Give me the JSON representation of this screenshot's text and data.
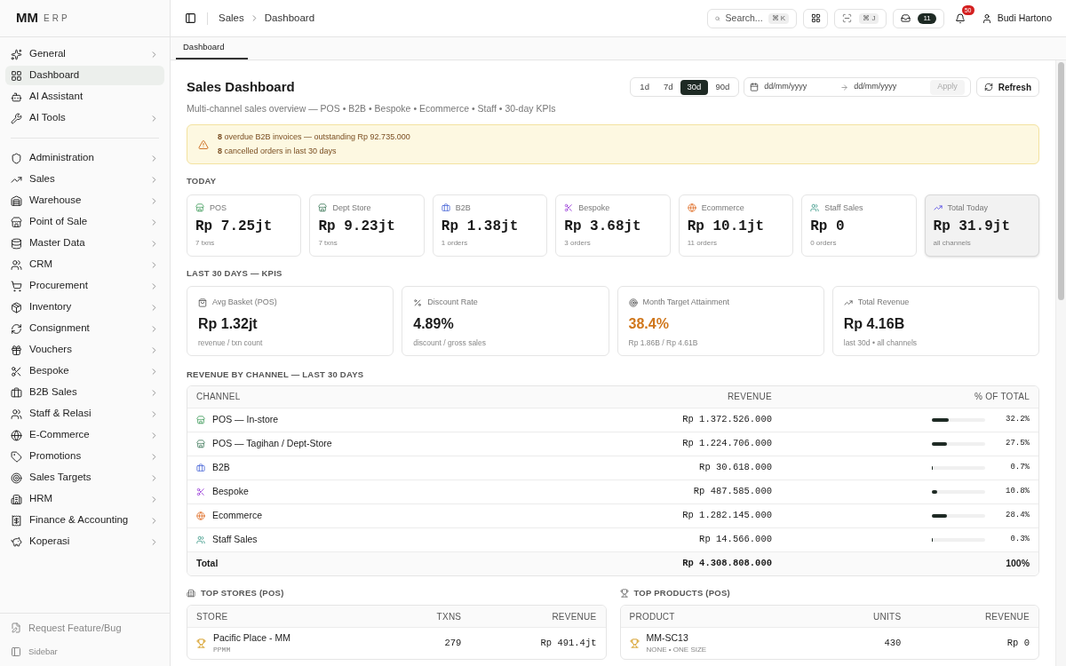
{
  "brand": {
    "name": "MM",
    "suffix": "ERP"
  },
  "sidebar": {
    "groups": [
      [
        {
          "label": "General",
          "expandable": true,
          "selected": false
        },
        {
          "label": "Dashboard",
          "expandable": false,
          "selected": true
        },
        {
          "label": "AI Assistant",
          "expandable": false,
          "selected": false
        },
        {
          "label": "AI Tools",
          "expandable": true,
          "selected": false
        }
      ],
      [
        {
          "label": "Administration",
          "expandable": true,
          "selected": false
        },
        {
          "label": "Sales",
          "expandable": true,
          "selected": false
        },
        {
          "label": "Warehouse",
          "expandable": true,
          "selected": false
        },
        {
          "label": "Point of Sale",
          "expandable": true,
          "selected": false
        },
        {
          "label": "Master Data",
          "expandable": true,
          "selected": false
        },
        {
          "label": "CRM",
          "expandable": true,
          "selected": false
        },
        {
          "label": "Procurement",
          "expandable": true,
          "selected": false
        },
        {
          "label": "Inventory",
          "expandable": true,
          "selected": false
        },
        {
          "label": "Consignment",
          "expandable": true,
          "selected": false
        },
        {
          "label": "Vouchers",
          "expandable": true,
          "selected": false
        },
        {
          "label": "Bespoke",
          "expandable": true,
          "selected": false
        },
        {
          "label": "B2B Sales",
          "expandable": true,
          "selected": false
        },
        {
          "label": "Staff & Relasi",
          "expandable": true,
          "selected": false
        },
        {
          "label": "E-Commerce",
          "expandable": true,
          "selected": false
        },
        {
          "label": "Promotions",
          "expandable": true,
          "selected": false
        },
        {
          "label": "Sales Targets",
          "expandable": true,
          "selected": false
        },
        {
          "label": "HRM",
          "expandable": true,
          "selected": false
        },
        {
          "label": "Finance & Accounting",
          "expandable": true,
          "selected": false
        },
        {
          "label": "Koperasi",
          "expandable": true,
          "selected": false
        }
      ]
    ],
    "footer": [
      "Request Feature/Bug",
      "Sidebar"
    ]
  },
  "breadcrumb": [
    "Sales",
    "Dashboard"
  ],
  "topbar": {
    "search_placeholder": "Search...",
    "search_shortcut": "⌘ K",
    "scan_shortcut": "⌘ J",
    "inbox_count": "11",
    "notification_count": "50",
    "user": "Budi Hartono"
  },
  "tabs": [
    {
      "label": "Dashboard",
      "selected": true
    }
  ],
  "page": {
    "title": "Sales Dashboard",
    "subtitle": "Multi-channel sales overview — POS • B2B • Bespoke • Ecommerce • Staff • 30-day KPIs",
    "periods": [
      {
        "label": "1d",
        "selected": false
      },
      {
        "label": "7d",
        "selected": false
      },
      {
        "label": "30d",
        "selected": true
      },
      {
        "label": "90d",
        "selected": false
      }
    ],
    "date_from": {
      "placeholder": "dd/mm/yyyy"
    },
    "date_to": {
      "placeholder": "dd/mm/yyyy"
    },
    "apply": "Apply",
    "refresh": "Refresh"
  },
  "alert": [
    "**8** overdue B2B invoices — outstanding Rp 92.735.000",
    "**8** cancelled orders in last 30 days"
  ],
  "today": {
    "heading": "TODAY",
    "cards": [
      {
        "label": "POS",
        "value": "Rp 7.25jt",
        "note": "7 txns",
        "highlighted": false
      },
      {
        "label": "Dept Store",
        "value": "Rp 9.23jt",
        "note": "7 txns",
        "highlighted": false
      },
      {
        "label": "B2B",
        "value": "Rp 1.38jt",
        "note": "1 orders",
        "highlighted": false
      },
      {
        "label": "Bespoke",
        "value": "Rp 3.68jt",
        "note": "3 orders",
        "highlighted": false
      },
      {
        "label": "Ecommerce",
        "value": "Rp 10.1jt",
        "note": "11 orders",
        "highlighted": false
      },
      {
        "label": "Staff Sales",
        "value": "Rp 0",
        "note": "0 orders",
        "highlighted": false
      },
      {
        "label": "Total Today",
        "value": "Rp 31.9jt",
        "note": "all channels",
        "highlighted": true
      }
    ]
  },
  "kpis": {
    "heading": "LAST 30 DAYS — KPIS",
    "cards": [
      {
        "label": "Avg Basket (POS)",
        "value": "Rp 1.32jt",
        "note": "revenue / txn count",
        "accent": false
      },
      {
        "label": "Discount Rate",
        "value": "4.89%",
        "note": "discount / gross sales",
        "accent": false
      },
      {
        "label": "Month Target Attainment",
        "value": "38.4%",
        "note": "Rp 1.86B / Rp 4.61B",
        "accent": true
      },
      {
        "label": "Total Revenue",
        "value": "Rp 4.16B",
        "note": "last 30d • all channels",
        "accent": false
      }
    ]
  },
  "revenue_by_channel": {
    "heading": "REVENUE BY CHANNEL — LAST 30 DAYS",
    "columns": [
      "CHANNEL",
      "REVENUE",
      "% OF TOTAL"
    ],
    "rows": [
      {
        "channel": "POS — In-store",
        "revenue": "Rp 1.372.526.000",
        "share": "32.2%",
        "level": 0.322
      },
      {
        "channel": "POS — Tagihan / Dept-Store",
        "revenue": "Rp 1.224.706.000",
        "share": "27.5%",
        "level": 0.275
      },
      {
        "channel": "B2B",
        "revenue": "Rp 30.618.000",
        "share": "0.7%",
        "level": 0.007
      },
      {
        "channel": "Bespoke",
        "revenue": "Rp 487.585.000",
        "share": "10.8%",
        "level": 0.108
      },
      {
        "channel": "Ecommerce",
        "revenue": "Rp 1.282.145.000",
        "share": "28.4%",
        "level": 0.284
      },
      {
        "channel": "Staff Sales",
        "revenue": "Rp 14.566.000",
        "share": "0.3%",
        "level": 0.003
      }
    ],
    "total": {
      "label": "Total",
      "revenue": "Rp 4.308.808.000",
      "share": "100%"
    }
  },
  "top_stores": {
    "heading": "TOP STORES (POS)",
    "columns": [
      "STORE",
      "TXNS",
      "REVENUE"
    ],
    "rows": [
      {
        "name": "Pacific Place - MM",
        "code": "PPMM",
        "txns": "279",
        "revenue": "Rp 491.4jt"
      }
    ]
  },
  "top_products": {
    "heading": "TOP PRODUCTS (POS)",
    "columns": [
      "PRODUCT",
      "UNITS",
      "REVENUE"
    ],
    "rows": [
      {
        "name": "MM-SC13",
        "variant": "NONE • ONE SIZE",
        "units": "430",
        "revenue": "Rp 0"
      }
    ]
  }
}
